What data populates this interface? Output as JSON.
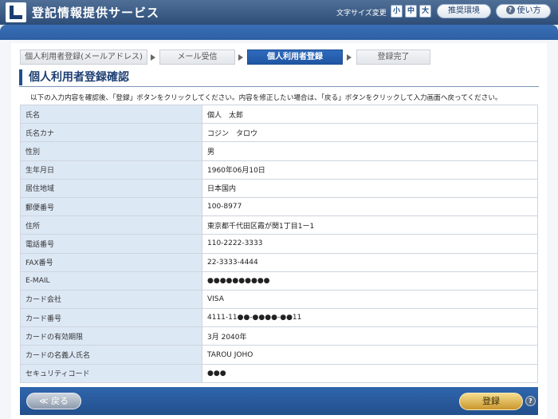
{
  "header": {
    "app_title": "登記情報提供サービス",
    "font_size_label": "文字サイズ変更",
    "font_sizes": [
      "小",
      "中",
      "大"
    ],
    "recommended_env": "推奨環境",
    "howto": "使い方",
    "help_glyph": "?"
  },
  "steps": [
    {
      "label": "個人利用者登録(メールアドレス)",
      "active": false
    },
    {
      "label": "メール受信",
      "active": false
    },
    {
      "label": "個人利用者登録",
      "active": true
    },
    {
      "label": "登録完了",
      "active": false
    }
  ],
  "page_title": "個人利用者登録確認",
  "intro_text": "以下の入力内容を確認後、「登録」ボタンをクリックしてください。内容を修正したい場合は、「戻る」ボタンをクリックして入力画面へ戻ってください。",
  "rows": [
    {
      "label": "氏名",
      "value": "個人　太郎"
    },
    {
      "label": "氏名カナ",
      "value": "コジン　タロウ"
    },
    {
      "label": "性別",
      "value": "男"
    },
    {
      "label": "生年月日",
      "value": "1960年06月10日"
    },
    {
      "label": "居住地域",
      "value": "日本国内"
    },
    {
      "label": "郵便番号",
      "value": "100-8977"
    },
    {
      "label": "住所",
      "value": "東京都千代田区霞が関1丁目1ー1"
    },
    {
      "label": "電話番号",
      "value": "110-2222-3333"
    },
    {
      "label": "FAX番号",
      "value": "22-3333-4444"
    },
    {
      "label": "E-MAIL",
      "value": "●●●●●●●●●●"
    },
    {
      "label": "カード会社",
      "value": "VISA"
    },
    {
      "label": "カード番号",
      "value": "4111-11●●-●●●●-●●11"
    },
    {
      "label": "カードの有効期限",
      "value": "3月 2040年"
    },
    {
      "label": "カードの名義人氏名",
      "value": "TAROU JOHO"
    },
    {
      "label": "セキュリティコード",
      "value": "●●●"
    }
  ],
  "footer": {
    "back_label": "戻る",
    "back_icon": "≪",
    "register_label": "登録",
    "help_glyph": "?"
  }
}
